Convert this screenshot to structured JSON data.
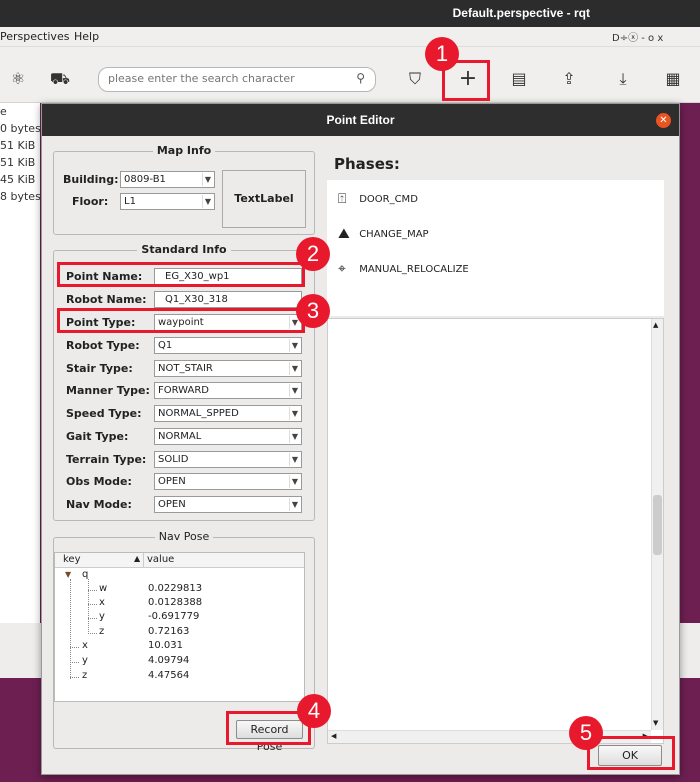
{
  "window": {
    "title": "Default.perspective - rqt",
    "controls": "D÷ⓧ  - o x"
  },
  "menu": {
    "perspectives": "Perspectives",
    "help": "Help"
  },
  "toolbar": {
    "search_placeholder": "please enter the search character"
  },
  "file_sizes": [
    "e",
    "0 bytes",
    "51 KiB",
    "51 KiB",
    "45 KiB",
    "8 bytes"
  ],
  "dialog": {
    "title": "Point Editor",
    "map_info": {
      "legend": "Map Info",
      "building_label": "Building:",
      "building_value": "0809-B1",
      "floor_label": "Floor:",
      "floor_value": "L1",
      "text_label": "TextLabel"
    },
    "standard_info": {
      "legend": "Standard Info",
      "point_name_label": "Point Name:",
      "point_name_value": "EG_X30_wp1",
      "robot_name_label": "Robot Name:",
      "robot_name_value": "Q1_X30_318",
      "fields": [
        {
          "label": "Point Type:",
          "value": "waypoint"
        },
        {
          "label": "Robot Type:",
          "value": "Q1"
        },
        {
          "label": "Stair Type:",
          "value": "NOT_STAIR"
        },
        {
          "label": "Manner Type:",
          "value": "FORWARD"
        },
        {
          "label": "Speed Type:",
          "value": "NORMAL_SPPED"
        },
        {
          "label": "Gait Type:",
          "value": "NORMAL"
        },
        {
          "label": "Terrain Type:",
          "value": "SOLID"
        },
        {
          "label": "Obs Mode:",
          "value": "OPEN"
        },
        {
          "label": "Nav Mode:",
          "value": "OPEN"
        }
      ]
    },
    "nav_pose": {
      "legend": "Nav Pose",
      "col_key": "key",
      "col_value": "value",
      "rows": [
        {
          "key": "q",
          "value": ""
        },
        {
          "key": "w",
          "value": "0.0229813"
        },
        {
          "key": "x",
          "value": "0.0128388"
        },
        {
          "key": "y",
          "value": "-0.691779"
        },
        {
          "key": "z",
          "value": "0.72163"
        },
        {
          "key": "x",
          "value": "10.031"
        },
        {
          "key": "y",
          "value": "4.09794"
        },
        {
          "key": "z",
          "value": "4.47564"
        }
      ],
      "record_button": "Record Pose"
    },
    "phases": {
      "title": "Phases:",
      "items": [
        {
          "label": "DOOR_CMD",
          "icon": "door-icon"
        },
        {
          "label": "CHANGE_MAP",
          "icon": "map-icon"
        },
        {
          "label": "MANUAL_RELOCALIZE",
          "icon": "crosshair-icon"
        }
      ]
    },
    "ok_button": "OK"
  },
  "annotations": [
    "1",
    "2",
    "3",
    "4",
    "5"
  ],
  "annotation_color": "#e8192c"
}
